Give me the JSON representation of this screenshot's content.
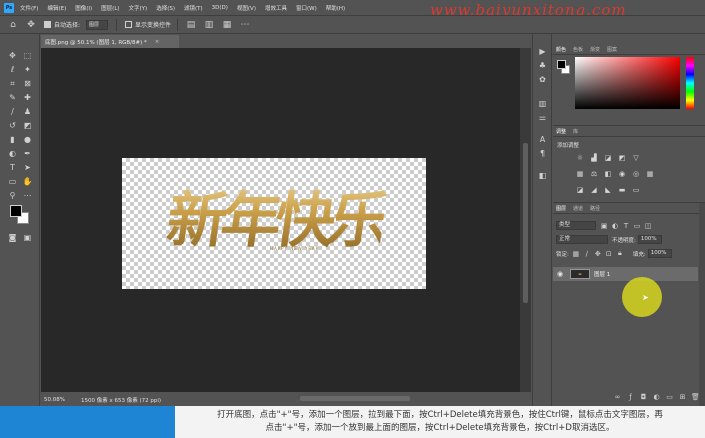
{
  "app": {
    "logo": "Ps"
  },
  "menu": [
    "文件(F)",
    "编辑(E)",
    "图像(I)",
    "图层(L)",
    "文字(Y)",
    "选择(S)",
    "滤镜(T)",
    "3D(D)",
    "视图(V)",
    "增效工具",
    "窗口(W)",
    "帮助(H)"
  ],
  "watermark": "www.baiyunxitong.com",
  "options": {
    "auto_select_label": "自动选择:",
    "auto_select_value": "图层",
    "show_transform_label": "显示变换控件"
  },
  "document": {
    "tab_title": "底图.png @ 50.1% (图层 1, RGB/8#) *",
    "close": "×"
  },
  "artwork": {
    "text": "新年快乐",
    "subtitle": "HAPPY NEW YEAR"
  },
  "status": {
    "zoom": "50.08%",
    "dimensions": "1500 像素 x 653 像素 (72 ppi)"
  },
  "color_panel": {
    "tabs": [
      "颜色",
      "色板",
      "渐变",
      "图案"
    ]
  },
  "adjust_panel": {
    "tabs": [
      "调整",
      "库"
    ],
    "title": "添加调整"
  },
  "layers_panel": {
    "tabs": [
      "图层",
      "通道",
      "路径"
    ],
    "filter_label": "类型",
    "blend_mode": "正常",
    "opacity_label": "不透明度:",
    "opacity_value": "100%",
    "lock_label": "锁定:",
    "fill_label": "填充:",
    "fill_value": "100%",
    "layer_name": "图层 1"
  },
  "caption": {
    "line1": "打开底图，点击\"+\"号，添加一个图层，拉到最下面，按Ctrl+Delete填充背景色，按住Ctrl键，鼠标点击文字图层，再",
    "line2": "点击\"+\"号，添加一个放到最上面的图层，按Ctrl+Delete填充背景色，按Ctrl+D取消选区。"
  },
  "colors": {
    "accent": "#31a8ff",
    "cursor": "#d6d61e",
    "gold": "#c9a24a"
  }
}
